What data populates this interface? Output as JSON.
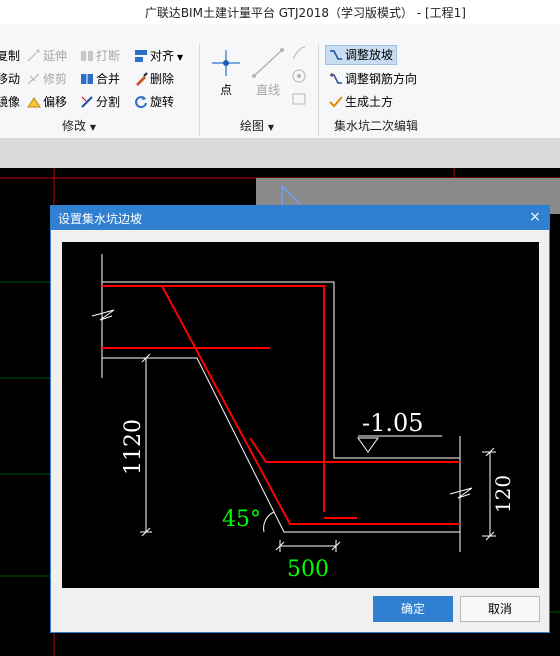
{
  "app": {
    "title": "广联达BIM土建计量平台 GTJ2018（学习版模式） - [工程1]"
  },
  "ribbon": {
    "modify": {
      "items": [
        {
          "label": "复制",
          "icon": "copy-icon",
          "enabled": true
        },
        {
          "label": "移动",
          "icon": "move-icon",
          "enabled": true
        },
        {
          "label": "镜像",
          "icon": "mirror-icon",
          "enabled": true
        },
        {
          "label": "延伸",
          "icon": "extend-icon",
          "enabled": false
        },
        {
          "label": "修剪",
          "icon": "trim-icon",
          "enabled": false
        },
        {
          "label": "偏移",
          "icon": "offset-icon",
          "enabled": true
        },
        {
          "label": "打断",
          "icon": "break-icon",
          "enabled": false
        },
        {
          "label": "合并",
          "icon": "merge-icon",
          "enabled": true
        },
        {
          "label": "分割",
          "icon": "split-icon",
          "enabled": true
        },
        {
          "label": "对齐",
          "icon": "align-icon",
          "enabled": true
        },
        {
          "label": "删除",
          "icon": "delete-icon",
          "enabled": true
        },
        {
          "label": "旋转",
          "icon": "rotate-icon",
          "enabled": true
        }
      ],
      "group_label": "修改"
    },
    "draw": {
      "point_label": "点",
      "line_label": "直线",
      "group_label": "绘图"
    },
    "sump": {
      "items": [
        {
          "label": "调整放坡",
          "icon": "adjust-slope-icon"
        },
        {
          "label": "调整钢筋方向",
          "icon": "adjust-rebar-direction-icon"
        },
        {
          "label": "生成土方",
          "icon": "generate-earthwork-icon"
        }
      ],
      "group_label": "集水坑二次编辑"
    }
  },
  "dialog": {
    "title": "设置集水坑边坡",
    "close_icon": "×",
    "diagram": {
      "elevation": "-1.05",
      "depth": "1120",
      "angle": "45°",
      "width": "500",
      "thickness": "120"
    },
    "ok_label": "确定",
    "cancel_label": "取消"
  },
  "colors": {
    "accent": "#2f80d1",
    "rebar": "#ff0000",
    "dim_green": "#00ff00"
  }
}
